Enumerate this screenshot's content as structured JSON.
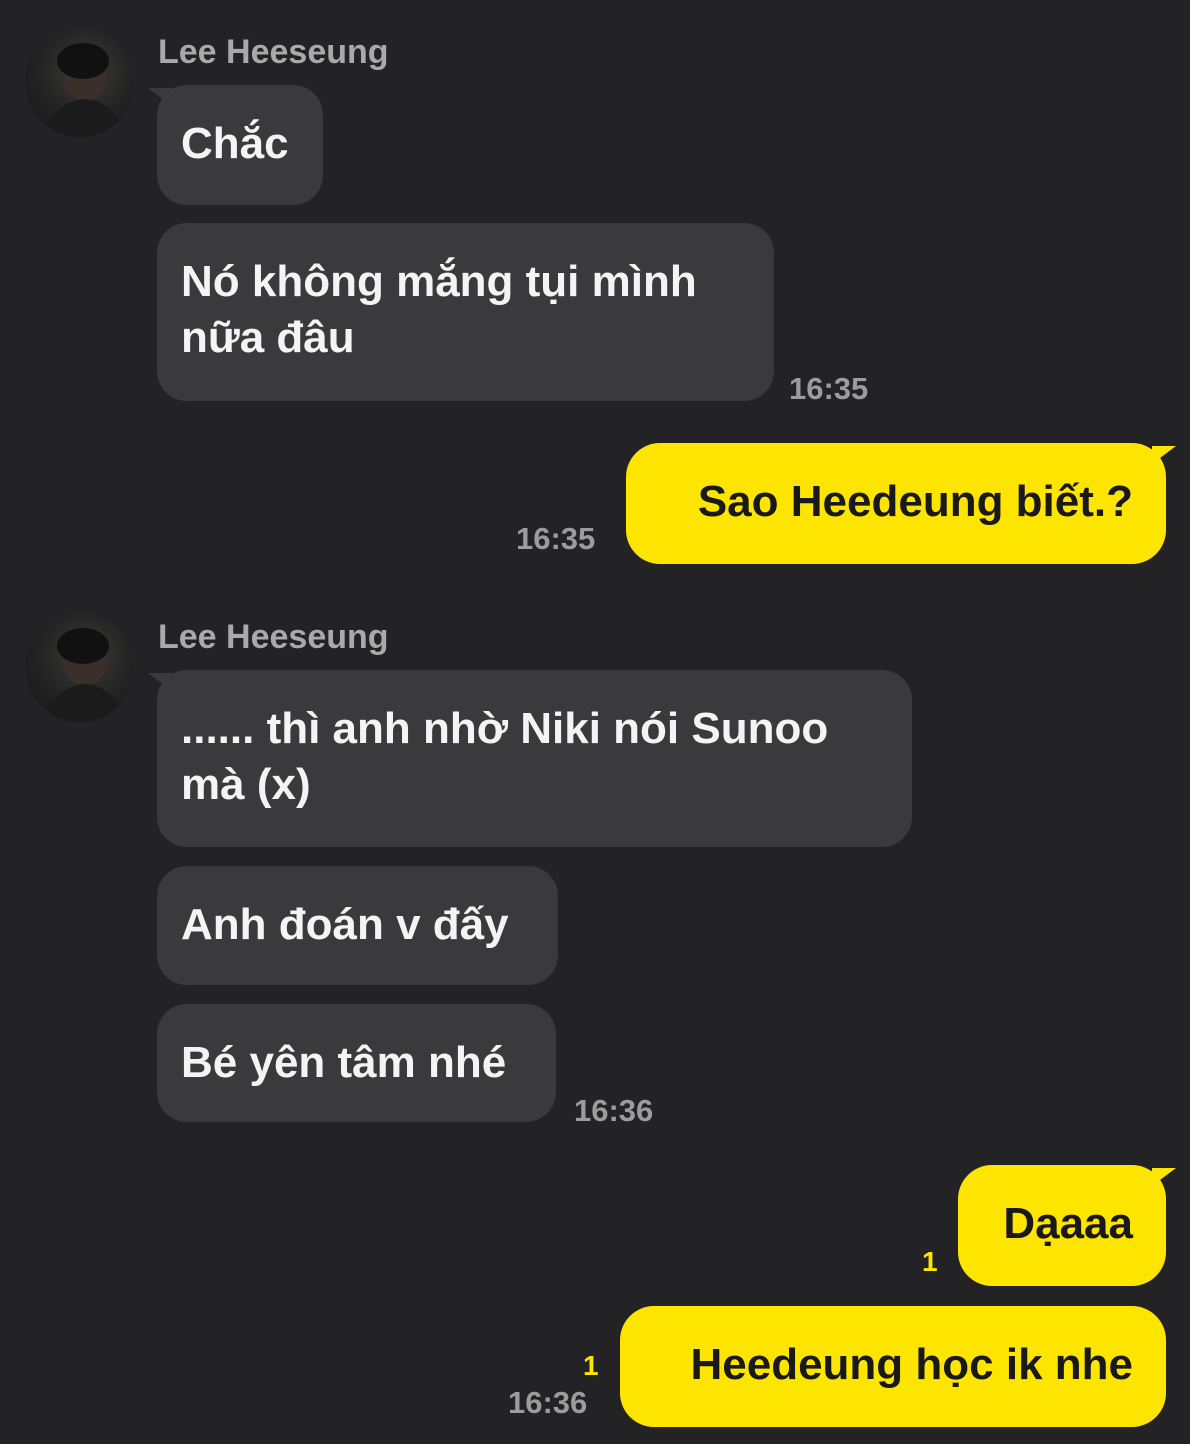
{
  "sender_name": "Lee Heeseung",
  "messages": [
    {
      "text": "Chắc"
    },
    {
      "text": "Nó không mắng tụi mình\nnữa đâu",
      "time": "16:35"
    },
    {
      "text": "Sao Heedeung biết.?",
      "time": "16:35"
    },
    {
      "text": "...... thì anh nhờ Niki nói Sunoo\nmà (x)"
    },
    {
      "text": "Anh đoán v đấy"
    },
    {
      "text": "Bé yên tâm nhé",
      "time": "16:36"
    },
    {
      "text": "Dạaaa",
      "unread": "1"
    },
    {
      "text": "Heedeung học ik nhe",
      "unread": "1",
      "time": "16:36"
    }
  ],
  "colors": {
    "background": "#232325",
    "incoming_bubble": "#3a3a3c",
    "outgoing_bubble": "#fee500",
    "unread_count": "#fee500"
  },
  "icons": {
    "avatar": "profile-photo"
  }
}
